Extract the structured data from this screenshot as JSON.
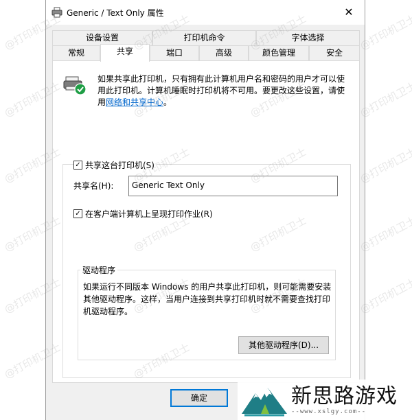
{
  "window": {
    "title": "Generic / Text Only 属性",
    "close_glyph": "✕"
  },
  "tabs_row1": [
    {
      "label": "设备设置"
    },
    {
      "label": "打印机命令"
    },
    {
      "label": "字体选择"
    }
  ],
  "tabs_row2": [
    {
      "label": "常规"
    },
    {
      "label": "共享",
      "active": true
    },
    {
      "label": "端口"
    },
    {
      "label": "高级"
    },
    {
      "label": "颜色管理"
    },
    {
      "label": "安全"
    }
  ],
  "info": {
    "text": "如果共享此打印机，只有拥有此计算机用户名和密码的用户才可以使用此打印机。计算机睡眠时打印机将不可用。要更改这些设置，请使用",
    "link": "网络和共享中心",
    "suffix": "。"
  },
  "share": {
    "checkbox_label": "共享这台打印机(S)",
    "checked": true,
    "name_label": "共享名(H):",
    "name_value": "Generic  Text Only"
  },
  "render": {
    "checkbox_label": "在客户端计算机上呈现打印作业(R)",
    "checked": true
  },
  "driver": {
    "legend": "驱动程序",
    "text": "如果运行不同版本 Windows 的用户共享此打印机，则可能需要安装其他驱动程序。这样，当用户连接到共享打印机时就不需要查找打印机驱动程序。",
    "button_label": "其他驱动程序(D)..."
  },
  "footer": {
    "ok_label": "确定"
  },
  "watermark": {
    "repeat_text": "@打印机卫士",
    "logo_title": "新思路游戏",
    "logo_url": "--www.xslgy.com--"
  },
  "colors": {
    "link": "#0066cc",
    "focus": "#0078d7",
    "check_badge": "#1e9e45"
  },
  "icons": {
    "title": "printer-icon",
    "share": "shared-printer-icon",
    "close": "close-icon"
  }
}
